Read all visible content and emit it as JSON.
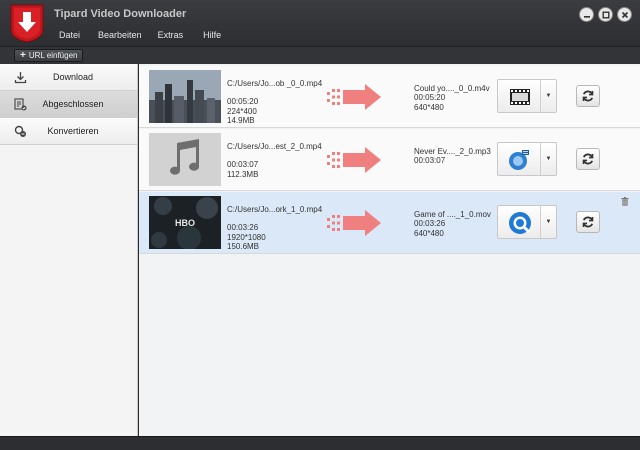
{
  "app": {
    "title": "Tipard Video Downloader"
  },
  "menu": [
    {
      "label": "Datei"
    },
    {
      "label": "Bearbeiten"
    },
    {
      "label": "Extras"
    },
    {
      "label": "Hilfe"
    }
  ],
  "toolbar": {
    "add_url_label": "URL einfügen"
  },
  "sidebar": {
    "items": [
      {
        "label": "Download",
        "icon": "download-icon"
      },
      {
        "label": "Abgeschlossen",
        "icon": "completed-icon",
        "active": true
      },
      {
        "label": "Konvertieren",
        "icon": "convert-icon"
      }
    ]
  },
  "rows": [
    {
      "source": {
        "path": "C:/Users/Jo...ob _0_0.mp4",
        "duration": "00:05:20",
        "resolution": "224*400",
        "size": "14.9MB"
      },
      "output": {
        "name": "Could yo...._0_0.m4v",
        "duration": "00:05:20",
        "resolution": "640*480"
      },
      "format_icon": "film-format-icon",
      "selected": false
    },
    {
      "source": {
        "path": "C:/Users/Jo...est_2_0.mp4",
        "duration": "00:03:07",
        "resolution": "",
        "size": "112.3MB"
      },
      "output": {
        "name": "Never Ev...._2_0.mp3",
        "duration": "00:03:07",
        "resolution": ""
      },
      "format_icon": "mp3-format-icon",
      "selected": false
    },
    {
      "source": {
        "path": "C:/Users/Jo...ork_1_0.mp4",
        "duration": "00:03:26",
        "resolution": "1920*1080",
        "size": "150.6MB",
        "thumb_text": "HBO"
      },
      "output": {
        "name": "Game of ...._1_0.mov",
        "duration": "00:03:26",
        "resolution": "640*480"
      },
      "format_icon": "quicktime-format-icon",
      "selected": true
    }
  ],
  "colors": {
    "accent_arrow": "#f07f7f",
    "selected_row": "#dbe8f7",
    "logo_red": "#c0161c"
  }
}
